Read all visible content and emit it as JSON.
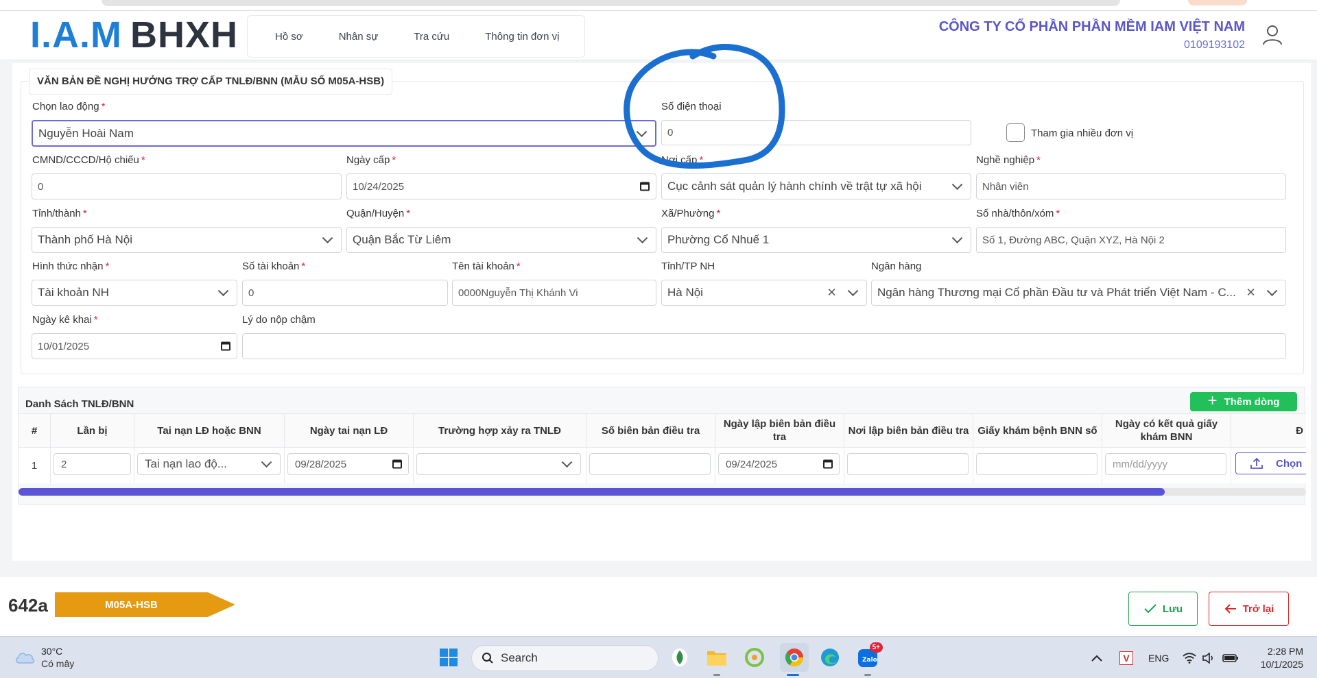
{
  "header": {
    "logo_iam": "I.A.M",
    "logo_bhxh": "BHXH",
    "nav": [
      "Hồ sơ",
      "Nhân sự",
      "Tra cứu",
      "Thông tin đơn vị"
    ],
    "company_name": "CÔNG TY CỔ PHẦN PHẦN MỀM IAM VIỆT NAM",
    "company_phone": "0109193102"
  },
  "form": {
    "title": "VĂN BẢN ĐỀ NGHỊ HƯỞNG TRỢ CẤP TNLĐ/BNN (MẪU SỐ M05A-HSB)",
    "required_mark": "*",
    "employee": {
      "label": "Chọn lao động",
      "value": "Nguyễn Hoài Nam"
    },
    "phone": {
      "label": "Số điện thoại",
      "value": "0"
    },
    "multi_unit": {
      "label": "Tham gia nhiều đơn vị",
      "checked": false
    },
    "id_number": {
      "label": "CMND/CCCD/Hộ chiếu",
      "value": "0"
    },
    "issue_date": {
      "label": "Ngày cấp",
      "value": "10/24/2025"
    },
    "issue_place": {
      "label": "Nơi cấp",
      "value": "Cục cảnh sát quản lý hành chính về trật tự xã hội"
    },
    "occupation": {
      "label": "Nghề nghiệp",
      "value": "Nhân viên"
    },
    "province": {
      "label": "Tỉnh/thành",
      "value": "Thành phố Hà Nội"
    },
    "district": {
      "label": "Quận/Huyện",
      "value": "Quận Bắc Từ Liêm"
    },
    "ward": {
      "label": "Xã/Phường",
      "value": "Phường Cổ Nhuế 1"
    },
    "address": {
      "label": "Số nhà/thôn/xóm",
      "value": "Số 1, Đường ABC, Quận XYZ, Hà Nội 2"
    },
    "receive_method": {
      "label": "Hình thức nhận",
      "value": "Tài khoản NH"
    },
    "account_number": {
      "label": "Số tài khoản",
      "value": "0"
    },
    "account_name": {
      "label": "Tên tài khoản",
      "value": "0000Nguyễn Thị Khánh Vi"
    },
    "bank_province": {
      "label": "Tỉnh/TP NH",
      "value": "Hà Nội"
    },
    "bank": {
      "label": "Ngân hàng",
      "value": "Ngân hàng Thương mại Cổ phần Đầu tư và Phát triển Việt Nam - C..."
    },
    "declare_date": {
      "label": "Ngày kê khai",
      "value": "10/01/2025"
    },
    "late_reason": {
      "label": "Lý do nộp chậm",
      "value": ""
    }
  },
  "table": {
    "title": "Danh Sách TNLĐ/BNN",
    "add_label": "Thêm dòng",
    "headers": [
      "#",
      "Lần bị",
      "Tai nạn LĐ hoặc BNN",
      "Ngày tai nạn LĐ",
      "Trường hợp xảy ra TNLĐ",
      "Số biên bản điều tra",
      "Ngày lập biên bản điều tra",
      "Nơi lập biên bản điều tra",
      "Giấy khám bệnh BNN số",
      "Ngày có kết quả giấy khám BNN",
      "Đ"
    ],
    "row": {
      "index": "1",
      "times": "2",
      "type": "Tai nạn lao độ...",
      "accident_date": "09/28/2025",
      "case": "",
      "report_no": "",
      "report_date": "09/24/2025",
      "report_place": "",
      "bnn_no": "",
      "result_date_placeholder": "mm/dd/yyyy",
      "choose_label": "Chọn"
    },
    "scroll_fraction": 0.89
  },
  "footer": {
    "code": "642a",
    "form_tag": "M05A-HSB",
    "save_label": "Lưu",
    "back_label": "Trở lại",
    "tag_color": "#e69a12"
  },
  "taskbar": {
    "temperature": "30°C",
    "weather": "Có mây",
    "search": "Search",
    "notification_badge": "5+",
    "language": "ENG",
    "time": "2:28 PM",
    "date": "10/1/2025"
  },
  "annotation_color": "#1a6fd1"
}
